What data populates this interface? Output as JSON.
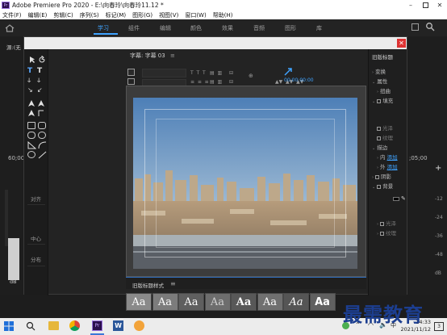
{
  "window": {
    "title": "Adobe Premiere Pro 2020 - E:\\向春玲\\向春玲11.12 *",
    "app_icon": "Pr",
    "controls": [
      "minimize-icon",
      "maximize-icon",
      "close-icon"
    ]
  },
  "menu": [
    "文件(F)",
    "编辑(E)",
    "剪辑(C)",
    "序列(S)",
    "标记(M)",
    "图形(G)",
    "视图(V)",
    "窗口(W)",
    "帮助(H)"
  ],
  "workspaces": {
    "items": [
      "学习",
      "组件",
      "编辑",
      "颜色",
      "效果",
      "音频",
      "图形",
      "库"
    ],
    "active": "学习"
  },
  "background_panels": {
    "left_label": "源:(无",
    "left_timecode": "60;00",
    "right_timecode": ";05;00",
    "left_meter": [
      "0",
      "-12",
      "-24",
      "-36",
      "-48",
      "dB"
    ],
    "right_meter": [
      "-12",
      "-24",
      "-36",
      "-48",
      "dB"
    ]
  },
  "dialog": {
    "tools": {
      "alignment": "对齐",
      "center": "中心",
      "distribute": "分布"
    },
    "title_panel": {
      "tab": "字幕: 字幕 03",
      "timecode": "00:00:00:00"
    },
    "styles_panel": {
      "tab": "旧版标题样式",
      "swatches": [
        "Aa",
        "Aa",
        "Aa",
        "Aa",
        "Aa",
        "Aa",
        "Aa",
        "Aa"
      ]
    },
    "properties": {
      "tab": "旧版标题",
      "rows": [
        "变换",
        "属性",
        "扭曲",
        "填充",
        "光泽",
        "纹理",
        "描边",
        "内",
        "添加",
        "外",
        "添加",
        "阴影",
        "背景",
        "光泽",
        "纹理"
      ]
    }
  },
  "taskbar": {
    "time": "14:33",
    "date": "2021/11/12",
    "notifications": "3"
  },
  "watermark": "最需教育",
  "colors": {
    "accent": "#3fa3ff",
    "title_bg": "#ffffff",
    "panel_bg": "#232323",
    "sky": "#6f9ccf"
  }
}
